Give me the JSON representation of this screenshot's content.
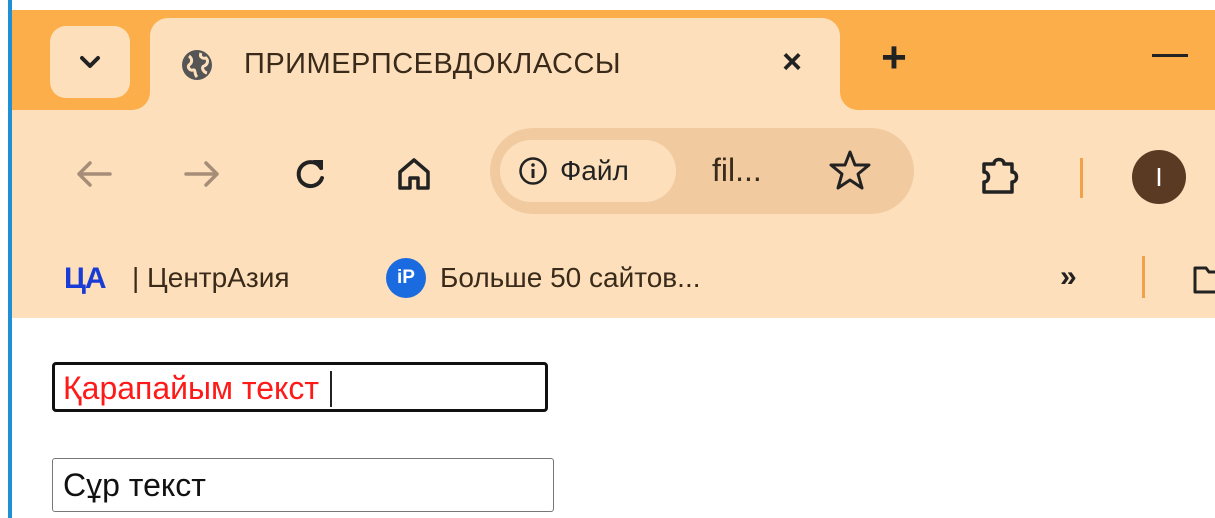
{
  "browser": {
    "tab": {
      "title": "ПРИМЕРПСЕВДОКЛАССЫ",
      "close_label": "×",
      "favicon": "globe-icon"
    },
    "new_tab_label": "+",
    "omnibox": {
      "chip_label": "Файл",
      "url": "fil..."
    },
    "avatar_letter": "I",
    "bookmarks": [
      {
        "logo": "ЦА",
        "label": "| ЦентрАзия"
      },
      {
        "logo": "iP",
        "label": "Больше 50 сайтов..."
      }
    ],
    "overflow_label": "»"
  },
  "page": {
    "input1_value": "Қарапайым текст",
    "input2_value": "Сұр текст"
  },
  "colors": {
    "tabstrip": "#fcae4a",
    "toolbar": "#fde0bb",
    "input1_text": "#ff1a1a",
    "bookmark_logo": "#1a3cd6"
  }
}
